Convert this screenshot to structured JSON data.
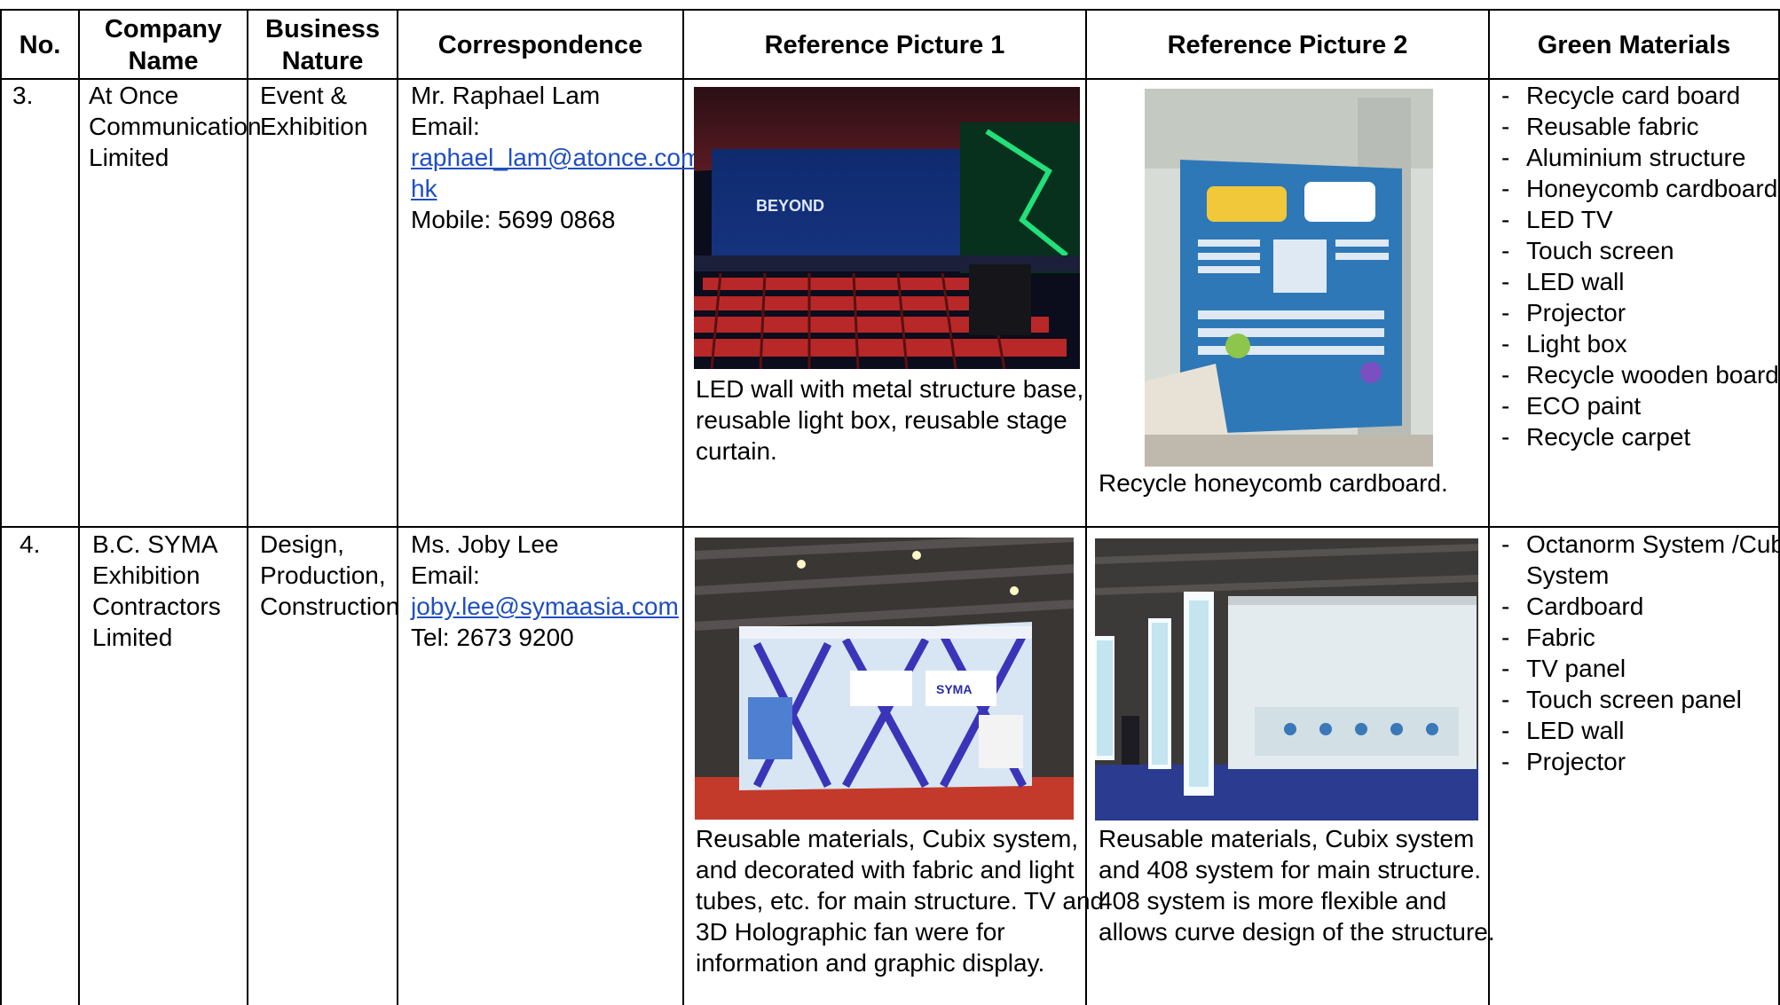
{
  "headers": {
    "no": "No.",
    "company_l1": "Company",
    "company_l2": "Name",
    "business_l1": "Business",
    "business_l2": "Nature",
    "correspondence": "Correspondence",
    "ref1": "Reference Picture 1",
    "ref2": "Reference Picture 2",
    "green": "Green Materials"
  },
  "rows": [
    {
      "no": "3.",
      "company": [
        "At Once",
        "Communication",
        "Limited"
      ],
      "business": [
        "Event &",
        "Exhibition"
      ],
      "contact_name": "Mr. Raphael Lam",
      "email_label": "Email:",
      "email_lines": [
        "raphael_lam@atonce.com.",
        "hk"
      ],
      "phone": "Mobile: 5699 0868",
      "ref1_caption": [
        "LED wall with metal structure base,",
        "reusable light box, reusable stage",
        "curtain."
      ],
      "ref1_sign": "BEYOND",
      "ref2_caption": [
        "Recycle honeycomb cardboard."
      ],
      "materials": [
        "Recycle card board",
        "Reusable fabric",
        "Aluminium structure",
        "Honeycomb cardboard",
        "LED TV",
        "Touch screen",
        "LED wall",
        "Projector",
        "Light box",
        "Recycle wooden board",
        "ECO paint",
        "Recycle carpet"
      ]
    },
    {
      "no": "4.",
      "company": [
        "B.C. SYMA",
        "Exhibition",
        "Contractors",
        "Limited"
      ],
      "business": [
        "Design,",
        "Production,",
        "Construction"
      ],
      "contact_name": "Ms. Joby Lee",
      "email_label": "Email:",
      "email_lines": [
        "joby.lee@symaasia.com"
      ],
      "phone": "Tel: 2673 9200",
      "ref1_caption": [
        "Reusable materials, Cubix system,",
        "and decorated with fabric and light",
        "tubes, etc. for main structure. TV and",
        "3D Holographic fan were for",
        "information and graphic display."
      ],
      "ref1_sign": "SYMA",
      "ref2_caption": [
        "Reusable materials, Cubix system",
        "and 408 system for main structure.",
        "408 system is more flexible and",
        "allows curve design of the structure."
      ],
      "materials": [
        "Octanorm System /Cubix",
        "System",
        "Cardboard",
        "Fabric",
        "TV panel",
        "Touch screen panel",
        "LED wall",
        "Projector"
      ]
    }
  ]
}
